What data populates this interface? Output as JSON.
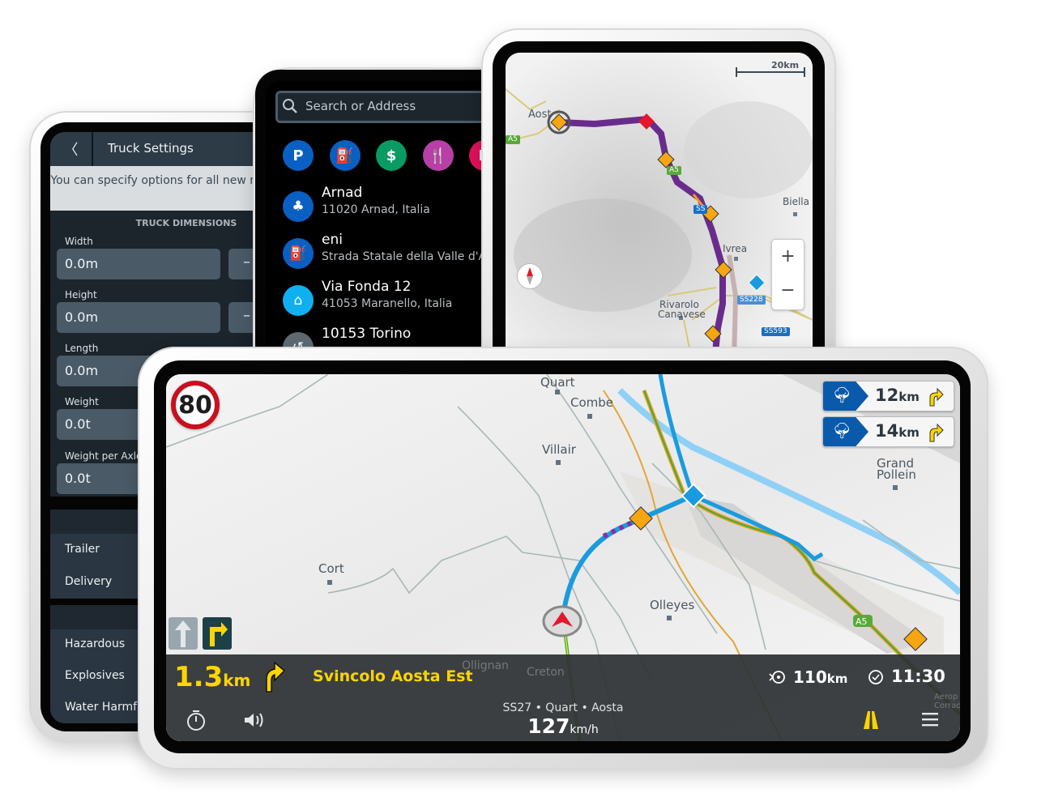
{
  "truck_settings": {
    "title": "Truck Settings",
    "info": "You can specify options for all new routes below.",
    "section": "TRUCK DIMENSIONS",
    "fields": [
      {
        "label": "Width",
        "value": "0.0m"
      },
      {
        "label": "Height",
        "value": "0.0m"
      },
      {
        "label": "Length",
        "value": "0.0m"
      },
      {
        "label": "Weight",
        "value": "0.0t"
      },
      {
        "label": "Weight per Axle",
        "value": "0.0t"
      }
    ],
    "minus_label": "–",
    "group1": [
      "Trailer",
      "Delivery"
    ],
    "group2": [
      "Hazardous",
      "Explosives",
      "Water Harmful"
    ]
  },
  "search": {
    "placeholder": "Search or Address",
    "categories": [
      {
        "icon": "parking-icon",
        "glyph": "P",
        "color": "#0a5fc2"
      },
      {
        "icon": "fuel-icon",
        "glyph": "⛽",
        "color": "#0a5fc2"
      },
      {
        "icon": "bank-icon",
        "glyph": "$",
        "color": "#0a9a63"
      },
      {
        "icon": "restaurant-icon",
        "glyph": "🍴",
        "color": "#b83fa6"
      },
      {
        "icon": "hotel-icon",
        "glyph": "H",
        "color": "#e0105a"
      }
    ],
    "results": [
      {
        "icon": "park-icon",
        "color": "#0a5fc2",
        "title": "Arnad",
        "subtitle": "11020 Arnad, Italia"
      },
      {
        "icon": "fuel-icon",
        "color": "#0a5fc2",
        "title": "eni",
        "subtitle": "Strada Statale della Valle d'A"
      },
      {
        "icon": "home-icon",
        "color": "#10b0f0",
        "title": "Via Fonda  12",
        "subtitle": "41053 Maranello, Italia"
      },
      {
        "icon": "history-icon",
        "color": "#5d6a73",
        "title": "10153 Torino",
        "subtitle": ""
      }
    ]
  },
  "overview_map": {
    "scale": "20km",
    "labels": [
      "Aost",
      "Biella",
      "Ivrea",
      "Rivarolo",
      "Canavese"
    ],
    "shields": [
      "A5",
      "A5",
      "SS",
      "SS228",
      "SS593"
    ],
    "zoom_in": "+",
    "zoom_out": "−",
    "route_color": "#6a2c8c"
  },
  "navigation": {
    "speed_limit": "80",
    "signs": [
      {
        "distance": "12",
        "unit": "km"
      },
      {
        "distance": "14",
        "unit": "km"
      }
    ],
    "map_labels": [
      "Quart",
      "Combe",
      "Villair",
      "Grand",
      "Pollein",
      "Cort",
      "Olleyes",
      "A5",
      "Ollignan",
      "Creton",
      "Aerop",
      "Corrad"
    ],
    "next_distance": "1.3",
    "next_unit": "km",
    "next_street": "Svincolo Aosta Est",
    "remaining_distance": "110",
    "remaining_unit": "km",
    "arrival_time": "11:30",
    "current_road": "SS27 • Quart • Aosta",
    "speed": "127",
    "speed_unit": "km/h",
    "accent": "#ffd500",
    "route_color": "#1a9be0"
  }
}
